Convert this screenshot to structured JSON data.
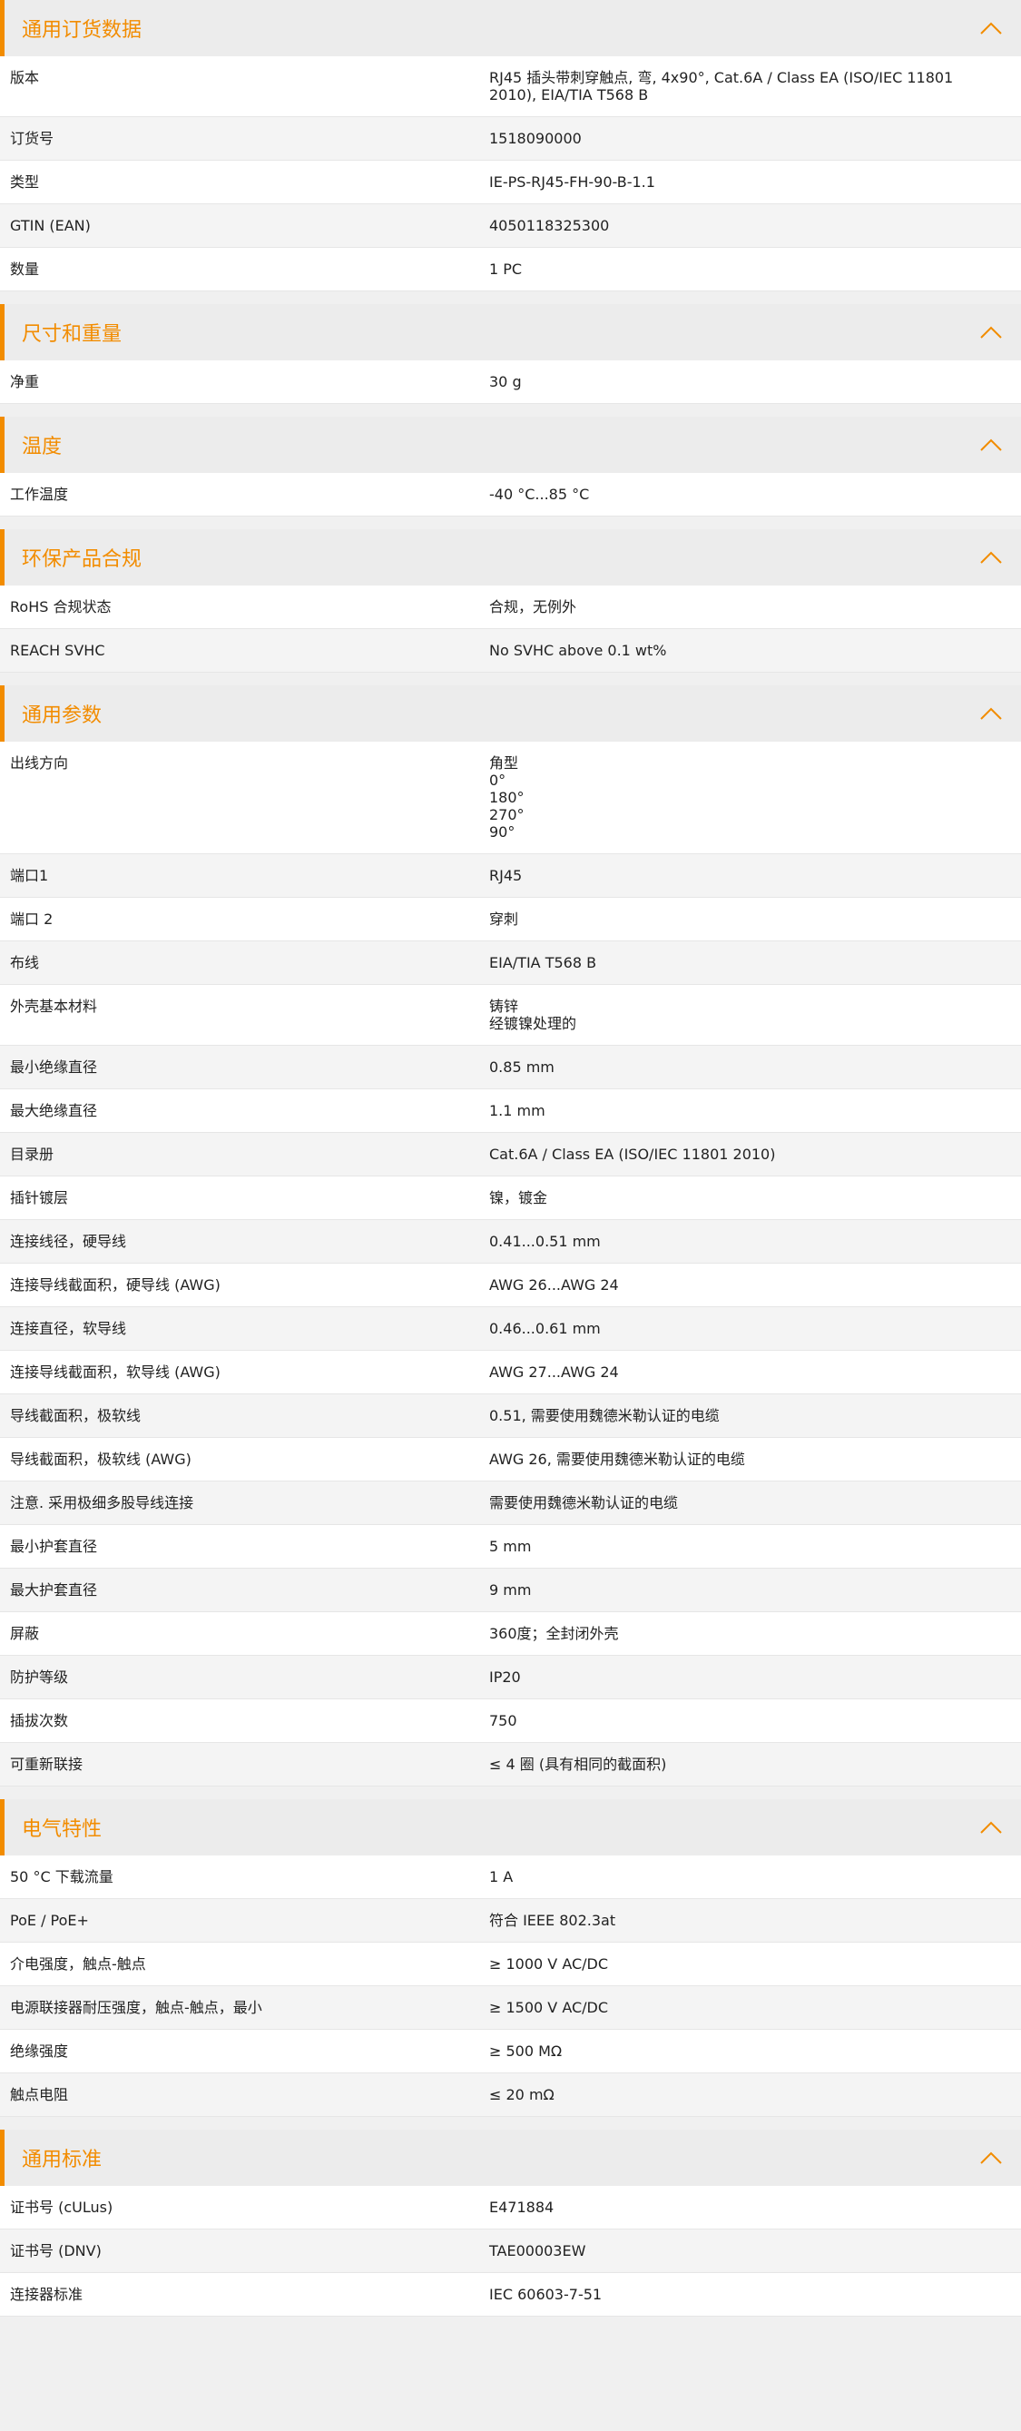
{
  "colors": {
    "accent": "#f28c00",
    "header_bg": "#ececec",
    "row_odd": "#ffffff",
    "row_even": "#f4f4f4"
  },
  "icons": {
    "collapse": "chevron-up-icon"
  },
  "sections": [
    {
      "title": "通用订货数据",
      "rows": [
        {
          "label": "版本",
          "value": [
            "RJ45 插头带刺穿触点, 弯, 4x90°, Cat.6A / Class EA (ISO/IEC 11801 2010), EIA/TIA T568 B"
          ]
        },
        {
          "label": "订货号",
          "value": [
            "1518090000"
          ]
        },
        {
          "label": "类型",
          "value": [
            "IE-PS-RJ45-FH-90-B-1.1"
          ]
        },
        {
          "label": "GTIN (EAN)",
          "value": [
            "4050118325300"
          ]
        },
        {
          "label": "数量",
          "value": [
            "1  PC"
          ]
        }
      ]
    },
    {
      "title": "尺寸和重量",
      "rows": [
        {
          "label": "净重",
          "value": [
            "30  g"
          ]
        }
      ]
    },
    {
      "title": "温度",
      "rows": [
        {
          "label": "工作温度",
          "value": [
            "-40 °C...85 °C"
          ]
        }
      ]
    },
    {
      "title": "环保产品合规",
      "rows": [
        {
          "label": "RoHS 合规状态",
          "value": [
            "合规，无例外"
          ]
        },
        {
          "label": "REACH SVHC",
          "value": [
            "No SVHC above 0.1 wt%"
          ]
        }
      ]
    },
    {
      "title": "通用参数",
      "rows": [
        {
          "label": "出线方向",
          "value": [
            "角型",
            "0°",
            "180°",
            "270°",
            "90°"
          ]
        },
        {
          "label": "端口1",
          "value": [
            "RJ45"
          ]
        },
        {
          "label": "端口 2",
          "value": [
            "穿刺"
          ]
        },
        {
          "label": "布线",
          "value": [
            "EIA/TIA T568 B"
          ]
        },
        {
          "label": "外壳基本材料",
          "value": [
            "铸锌",
            "经镀镍处理的"
          ]
        },
        {
          "label": "最小绝缘直径",
          "value": [
            "0.85  mm"
          ]
        },
        {
          "label": "最大绝缘直径",
          "value": [
            "1.1  mm"
          ]
        },
        {
          "label": "目录册",
          "value": [
            "Cat.6A / Class EA (ISO/IEC 11801 2010)"
          ]
        },
        {
          "label": "插针镀层",
          "value": [
            "镍，镀金"
          ]
        },
        {
          "label": "连接线径，硬导线",
          "value": [
            "0.41...0.51 mm"
          ]
        },
        {
          "label": "连接导线截面积，硬导线 (AWG)",
          "value": [
            "AWG 26...AWG 24"
          ]
        },
        {
          "label": "连接直径，软导线",
          "value": [
            "0.46...0.61 mm"
          ]
        },
        {
          "label": "连接导线截面积，软导线 (AWG)",
          "value": [
            "AWG 27...AWG 24"
          ]
        },
        {
          "label": "导线截面积，极软线",
          "value": [
            "0.51, 需要使用魏德米勒认证的电缆"
          ]
        },
        {
          "label": "导线截面积，极软线 (AWG)",
          "value": [
            "AWG 26, 需要使用魏德米勒认证的电缆"
          ]
        },
        {
          "label": "注意. 采用极细多股导线连接",
          "value": [
            "需要使用魏德米勒认证的电缆"
          ]
        },
        {
          "label": "最小护套直径",
          "value": [
            "5  mm"
          ]
        },
        {
          "label": "最大护套直径",
          "value": [
            "9  mm"
          ]
        },
        {
          "label": "屏蔽",
          "value": [
            "360度；全封闭外壳"
          ]
        },
        {
          "label": "防护等级",
          "value": [
            "IP20"
          ]
        },
        {
          "label": "插拔次数",
          "value": [
            "750"
          ]
        },
        {
          "label": "可重新联接",
          "value": [
            "≤ 4 圈 (具有相同的截面积)"
          ]
        }
      ]
    },
    {
      "title": "电气特性",
      "rows": [
        {
          "label": "50 °C 下载流量",
          "value": [
            "1  A"
          ]
        },
        {
          "label": "PoE / PoE+",
          "value": [
            "符合 IEEE 802.3at"
          ]
        },
        {
          "label": "介电强度，触点-触点",
          "value": [
            "≥ 1000 V AC/DC"
          ]
        },
        {
          "label": "电源联接器耐压强度，触点-触点，最小",
          "value": [
            "≥ 1500 V AC/DC"
          ]
        },
        {
          "label": "绝缘强度",
          "value": [
            "≥ 500 MΩ"
          ]
        },
        {
          "label": "触点电阻",
          "value": [
            "≤ 20 mΩ"
          ]
        }
      ]
    },
    {
      "title": "通用标准",
      "rows": [
        {
          "label": "证书号 (cULus)",
          "value": [
            "E471884"
          ]
        },
        {
          "label": "证书号 (DNV)",
          "value": [
            "TAE00003EW"
          ]
        },
        {
          "label": "连接器标准",
          "value": [
            "IEC 60603-7-51"
          ]
        }
      ]
    }
  ]
}
